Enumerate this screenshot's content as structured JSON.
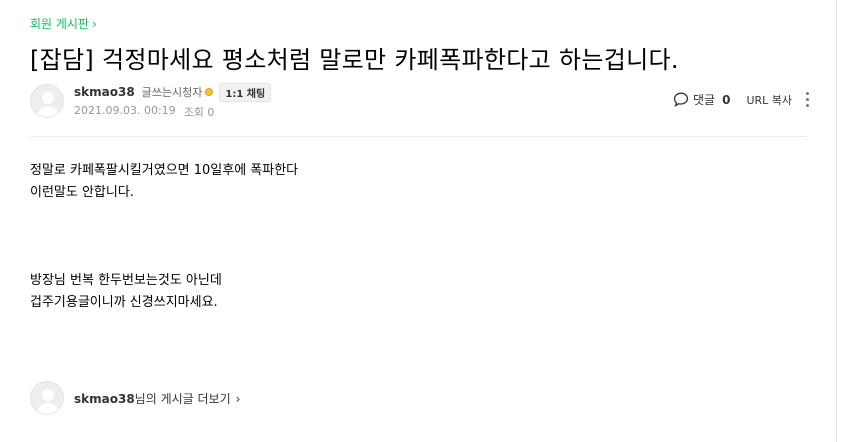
{
  "board": {
    "label": "회원 게시판",
    "chevron": "chevron-right-icon"
  },
  "post": {
    "title": "[잡담] 걱정마세요 평소처럼 말로만 카페폭파한다고 하는겁니다.",
    "author": {
      "nickname": "skmao38",
      "level": "글쓰는시청자",
      "chat_label": "1:1 채팅"
    },
    "date": "2021.09.03. 00:19",
    "views": "조회 0"
  },
  "tools": {
    "comment_label": "댓글",
    "comment_count": "0",
    "url_copy_label": "URL 복사"
  },
  "body_lines": [
    "정말로 카페폭팔시킬거였으면 10일후에 폭파한다",
    "이런말도 안합니다.",
    "",
    "",
    "",
    "방장님 번복 한두번보는것도 아닌데",
    "겁주기용글이니까 신경쓰지마세요."
  ],
  "author_posts": {
    "nickname": "skmao38",
    "suffix": "님의 게시글 더보기"
  },
  "colors": {
    "accent": "#03c75a",
    "level_badge": "#f5c32c"
  }
}
